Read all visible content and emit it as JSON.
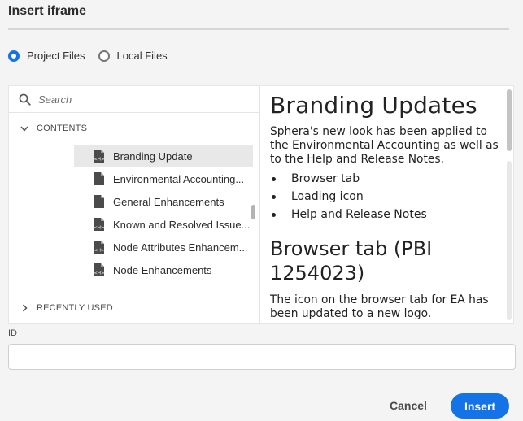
{
  "dialog": {
    "title": "Insert iframe"
  },
  "source_options": [
    {
      "label": "Project Files",
      "selected": true
    },
    {
      "label": "Local Files",
      "selected": false
    }
  ],
  "search": {
    "placeholder": "Search"
  },
  "sections": {
    "contents": "CONTENTS",
    "recent": "RECENTLY USED"
  },
  "tree_items": [
    {
      "label": "Branding Update",
      "selected": true
    },
    {
      "label": "Environmental Accounting...",
      "selected": false
    },
    {
      "label": "General Enhancements",
      "selected": false
    },
    {
      "label": "Known and Resolved Issue...",
      "selected": false
    },
    {
      "label": "Node Attributes Enhancem...",
      "selected": false
    },
    {
      "label": "Node Enhancements",
      "selected": false
    }
  ],
  "preview": {
    "heading": "Branding Updates",
    "intro": "Sphera's new look has been applied to the Environmental Accounting as well as to the Help and Release Notes.",
    "bullets": [
      "Browser tab",
      "Loading icon",
      "Help and Release Notes"
    ],
    "subheading": "Browser tab (PBI 1254023)",
    "body": "The icon on the browser tab for EA has been updated to a new logo."
  },
  "id_field": {
    "label": "ID",
    "value": ""
  },
  "buttons": {
    "cancel": "Cancel",
    "insert": "Insert"
  },
  "colors": {
    "accent": "#1473e6",
    "selected_row": "#e8e8e8"
  }
}
